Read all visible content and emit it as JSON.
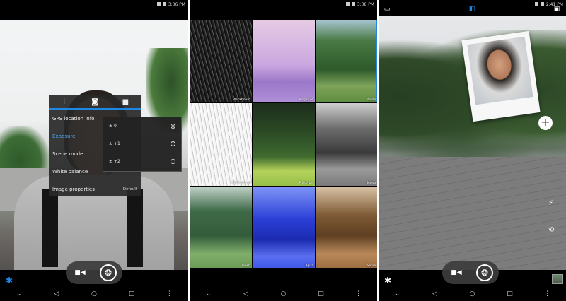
{
  "panel1": {
    "status_time": "3:06 PM",
    "menu": {
      "tabs": [
        "adjust",
        "photo",
        "video"
      ],
      "items": [
        {
          "label": "GPS location info",
          "value": ""
        },
        {
          "label": "Exposure",
          "value": ""
        },
        {
          "label": "Scene mode",
          "value": ""
        },
        {
          "label": "White balance",
          "value": ""
        },
        {
          "label": "Image properties",
          "value": "Default"
        }
      ]
    },
    "exposure_options": [
      {
        "label": "0",
        "selected": true
      },
      {
        "label": "+1",
        "selected": false
      },
      {
        "label": "+2",
        "selected": false
      }
    ]
  },
  "panel2": {
    "status_time": "3:08 PM",
    "effects": [
      {
        "label": "Blackboard",
        "cls": "t-blackboard",
        "selected": false
      },
      {
        "label": "Negative",
        "cls": "t-negative",
        "selected": false
      },
      {
        "label": "None",
        "cls": "t-none",
        "selected": true
      },
      {
        "label": "Whiteboard",
        "cls": "t-whiteboard",
        "selected": false
      },
      {
        "label": "Posterize",
        "cls": "t-posterize",
        "selected": false
      },
      {
        "label": "Mono",
        "cls": "t-mono",
        "selected": false
      },
      {
        "label": "Fresh",
        "cls": "t-fresh",
        "selected": false
      },
      {
        "label": "Aqua",
        "cls": "t-aqua",
        "selected": false
      },
      {
        "label": "Sepia",
        "cls": "t-sepia",
        "selected": false
      }
    ]
  },
  "panel3": {
    "status_time": "2:41 PM"
  },
  "icons": {
    "video": "■◀",
    "shutter": "❂",
    "gear": "✱",
    "back": "◁",
    "home": "○",
    "recent": "□",
    "more": "⋮",
    "down": "⌄",
    "flash": "⚡",
    "switch_cam": "⟲",
    "plus": "+"
  },
  "colors": {
    "accent": "#1e88e5"
  }
}
